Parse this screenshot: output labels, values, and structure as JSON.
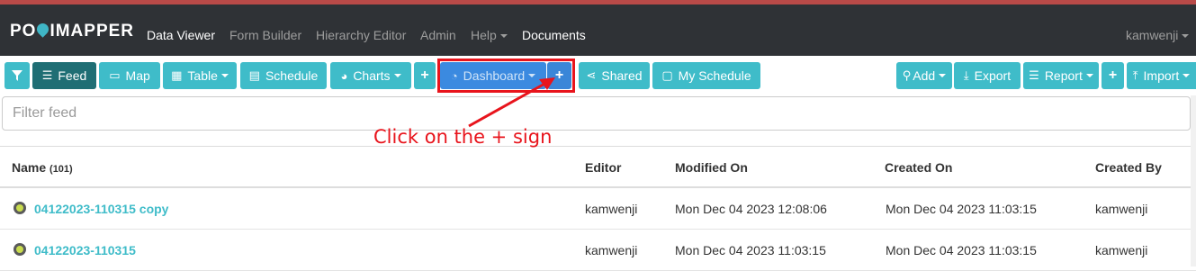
{
  "brand": {
    "name_left": "PO",
    "name_right": "IMAPPER"
  },
  "topnav": {
    "links": [
      "Data Viewer",
      "Form Builder",
      "Hierarchy Editor",
      "Admin",
      "Help",
      "Documents"
    ],
    "user": "kamwenji"
  },
  "toolbar": {
    "feed": "Feed",
    "map": "Map",
    "table": "Table",
    "schedule": "Schedule",
    "charts": "Charts",
    "dashboard": "Dashboard",
    "shared": "Shared",
    "my_schedule": "My Schedule",
    "add": "Add",
    "export": "Export",
    "report": "Report",
    "import": "Import"
  },
  "filter": {
    "placeholder": "Filter feed"
  },
  "annotation": "Click on the + sign",
  "table": {
    "headers": {
      "name": "Name",
      "count": "(101)",
      "editor": "Editor",
      "modified": "Modified On",
      "created": "Created On",
      "created_by": "Created By"
    },
    "rows": [
      {
        "name": "04122023-110315 copy",
        "editor": "kamwenji",
        "modified": "Mon Dec 04 2023 12:08:06",
        "created": "Mon Dec 04 2023 11:03:15",
        "created_by": "kamwenji"
      },
      {
        "name": "04122023-110315",
        "editor": "kamwenji",
        "modified": "Mon Dec 04 2023 11:03:15",
        "created": "Mon Dec 04 2023 11:03:15",
        "created_by": "kamwenji"
      }
    ]
  },
  "colors": {
    "accent": "#3fbcc9",
    "dark_accent": "#1f6e74",
    "navbar": "#2f3236",
    "highlight": "#e8141c",
    "dashboard": "#3b8ae0"
  }
}
